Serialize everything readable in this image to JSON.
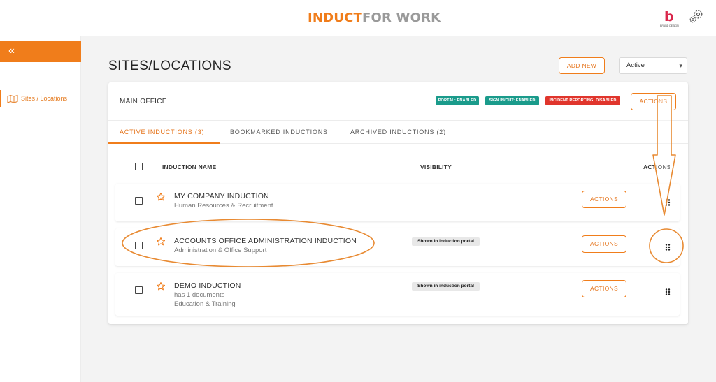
{
  "header": {
    "logo_part1": "INDUCT",
    "logo_part2": "FOR WORK",
    "brand_letter": "b",
    "brand_text": "BRAND DESIGN"
  },
  "sidebar": {
    "collapse_icon": "«",
    "items": [
      {
        "label": "Sites / Locations",
        "icon": "map-icon"
      }
    ]
  },
  "page": {
    "title": "SITES/LOCATIONS",
    "add_new_label": "ADD NEW",
    "status_filter": {
      "selected": "Active"
    }
  },
  "site": {
    "name": "MAIN OFFICE",
    "badges": [
      {
        "text": "PORTAL: ENABLED",
        "color": "#1a9b8b"
      },
      {
        "text": "SIGN IN/OUT: ENABLED",
        "color": "#1a9b8b"
      },
      {
        "text": "INCIDENT REPORTING: DISABLED",
        "color": "#e0352c"
      }
    ],
    "actions_label": "ACTIONS"
  },
  "tabs": [
    {
      "label": "ACTIVE INDUCTIONS (3)",
      "active": true
    },
    {
      "label": "BOOKMARKED INDUCTIONS",
      "active": false
    },
    {
      "label": "ARCHIVED INDUCTIONS (2)",
      "active": false
    }
  ],
  "table": {
    "columns": [
      "INDUCTION NAME",
      "VISIBILITY",
      "ACTIONS"
    ],
    "rows": [
      {
        "name": "MY COMPANY INDUCTION",
        "sub1": "Human Resources & Recruitment",
        "sub2": "",
        "visibility": "",
        "actions": "ACTIONS"
      },
      {
        "name": "ACCOUNTS OFFICE ADMINISTRATION INDUCTION",
        "sub1": "Administration & Office Support",
        "sub2": "",
        "visibility": "Shown in induction portal",
        "actions": "ACTIONS"
      },
      {
        "name": "DEMO INDUCTION",
        "sub1": "has 1 documents",
        "sub2": "Education & Training",
        "visibility": "Shown in induction portal",
        "actions": "ACTIONS"
      }
    ]
  },
  "colors": {
    "accent": "#f07d1b",
    "teal": "#1a9b8b",
    "red": "#e0352c"
  }
}
